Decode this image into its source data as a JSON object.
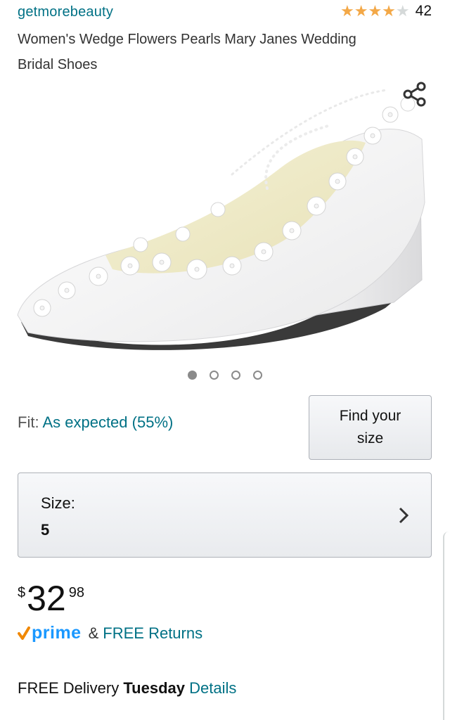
{
  "product": {
    "brand": "getmorebeauty",
    "rating_stars": 4,
    "rating_max": 5,
    "rating_count": "42",
    "title_line1": "Women's Wedge Flowers Pearls Mary Janes Wedding",
    "title_line2": "Bridal Shoes"
  },
  "gallery": {
    "image_count": 4,
    "active_index": 0,
    "share_icon": "share-icon"
  },
  "fit": {
    "label": "Fit: ",
    "value": "As expected (55%)"
  },
  "find_size": {
    "line1": "Find your",
    "line2": "size"
  },
  "size": {
    "label": "Size:",
    "value": "5"
  },
  "price": {
    "currency": "$",
    "whole": "32",
    "fraction": "98"
  },
  "prime": {
    "word": "prime",
    "amp": "&",
    "returns": "FREE Returns"
  },
  "delivery": {
    "prefix": "FREE Delivery ",
    "day": "Tuesday",
    "details": "Details"
  },
  "colors": {
    "link": "#007185",
    "star": "#f3a847",
    "prime": "#1a98ff",
    "prime_check": "#f08804"
  }
}
